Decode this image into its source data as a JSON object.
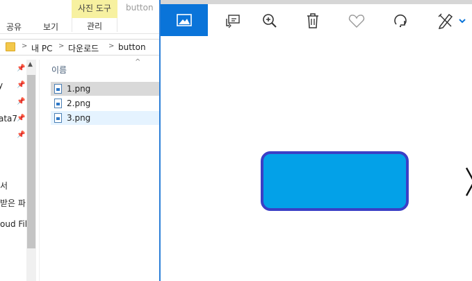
{
  "explorer": {
    "context_tab_group": "사진 도구",
    "document_name": "button",
    "ribbon_tabs": [
      "공유",
      "보기",
      "관리"
    ],
    "breadcrumb": [
      "내 PC",
      "다운로드",
      "button"
    ],
    "nav_items": [
      "y",
      "ata7",
      "서",
      "받은 파",
      "oud Fil"
    ],
    "column_header": "이름",
    "files": [
      "1.png",
      "2.png",
      "3.png"
    ]
  },
  "viewer": {
    "toolbar_icons": [
      "photos-icon",
      "slideshow-icon",
      "zoom-icon",
      "delete-icon",
      "favorite-icon",
      "rotate-icon",
      "edit-icon"
    ],
    "accent": "#0a74d9",
    "shape_fill": "#03a1e8",
    "shape_border": "#3b3fc6"
  }
}
